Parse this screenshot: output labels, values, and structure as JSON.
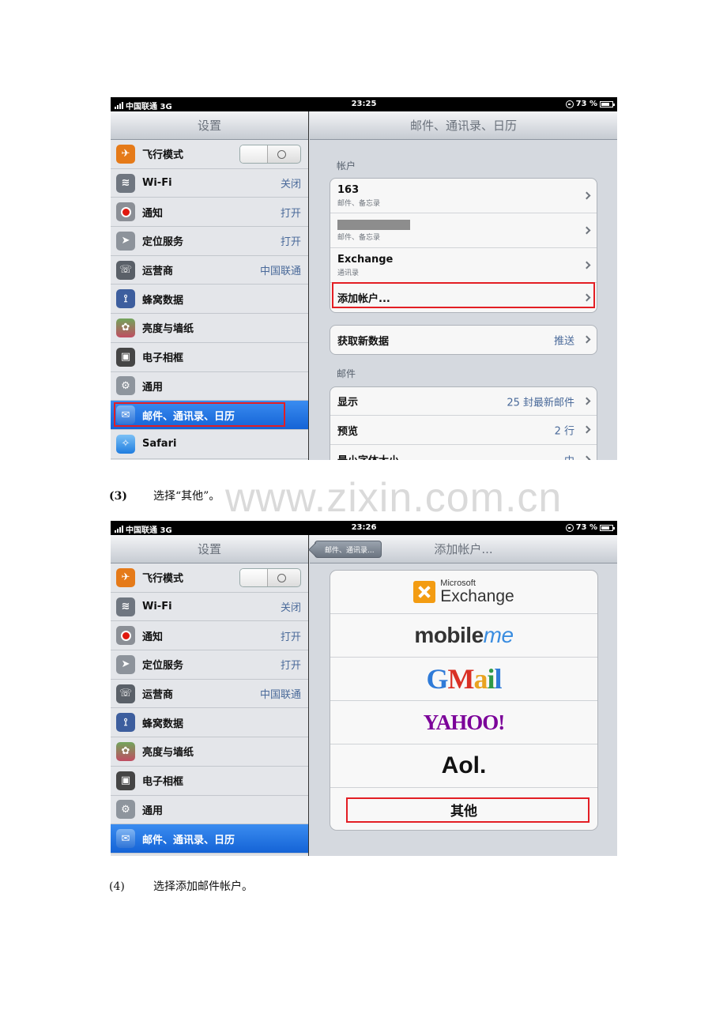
{
  "shot1": {
    "status": {
      "carrier": "中国联通 3G",
      "time": "23:25",
      "battery": "73 %"
    },
    "master_title": "设置",
    "detail_title": "邮件、通讯录、日历",
    "master_items": [
      {
        "label": "飞行模式",
        "value": "",
        "icon": "airplane-icon"
      },
      {
        "label": "Wi-Fi",
        "value": "关闭",
        "icon": "wifi-icon"
      },
      {
        "label": "通知",
        "value": "打开",
        "icon": "notification-icon"
      },
      {
        "label": "定位服务",
        "value": "打开",
        "icon": "location-icon"
      },
      {
        "label": "运营商",
        "value": "中国联通",
        "icon": "carrier-icon"
      },
      {
        "label": "蜂窝数据",
        "value": "",
        "icon": "cellular-icon"
      },
      {
        "label": "亮度与墙纸",
        "value": "",
        "icon": "brightness-icon"
      },
      {
        "label": "电子相框",
        "value": "",
        "icon": "picture-frame-icon"
      },
      {
        "label": "通用",
        "value": "",
        "icon": "general-icon"
      },
      {
        "label": "邮件、通讯录、日历",
        "value": "",
        "icon": "mail-icon"
      },
      {
        "label": "Safari",
        "value": "",
        "icon": "safari-icon"
      }
    ],
    "accounts_header": "帐户",
    "accounts": [
      {
        "name": "163",
        "sub": "邮件、备忘录"
      },
      {
        "name": "",
        "sub": "邮件、备忘录"
      },
      {
        "name": "Exchange",
        "sub": "通讯录"
      },
      {
        "name": "添加帐户...",
        "sub": ""
      }
    ],
    "fetch": {
      "label": "获取新数据",
      "value": "推送"
    },
    "mail_header": "邮件",
    "mail_rows": [
      {
        "label": "显示",
        "value": "25 封最新邮件"
      },
      {
        "label": "预览",
        "value": "2 行"
      },
      {
        "label": "最小字体大小",
        "value": "中"
      }
    ]
  },
  "caption3": {
    "num": "(3)",
    "text": "选择“其他”。"
  },
  "watermark": "www.zixin.com.cn",
  "shot2": {
    "status": {
      "carrier": "中国联通 3G",
      "time": "23:26",
      "battery": "73 %"
    },
    "master_title": "设置",
    "back_label": "邮件、通讯录...",
    "detail_title": "添加帐户...",
    "master_items": [
      {
        "label": "飞行模式",
        "value": ""
      },
      {
        "label": "Wi-Fi",
        "value": "关闭"
      },
      {
        "label": "通知",
        "value": "打开"
      },
      {
        "label": "定位服务",
        "value": "打开"
      },
      {
        "label": "运营商",
        "value": "中国联通"
      },
      {
        "label": "蜂窝数据",
        "value": ""
      },
      {
        "label": "亮度与墙纸",
        "value": ""
      },
      {
        "label": "电子相框",
        "value": ""
      },
      {
        "label": "通用",
        "value": ""
      },
      {
        "label": "邮件、通讯录、日历",
        "value": ""
      }
    ],
    "providers": {
      "exchange_ms": "Microsoft",
      "exchange_name": "Exchange",
      "mobileme_a": "mobile",
      "mobileme_b": "me",
      "gmail": [
        "G",
        "M",
        "a",
        "i",
        "l"
      ],
      "yahoo": "YAHOO!",
      "aol": "Aol.",
      "other": "其他"
    }
  },
  "caption4": {
    "num": "(4)",
    "text": "选择添加邮件帐户。"
  },
  "colors": {
    "highlight": "#e31e24",
    "selected": "#1463d6",
    "value_text": "#4a6a9a"
  }
}
